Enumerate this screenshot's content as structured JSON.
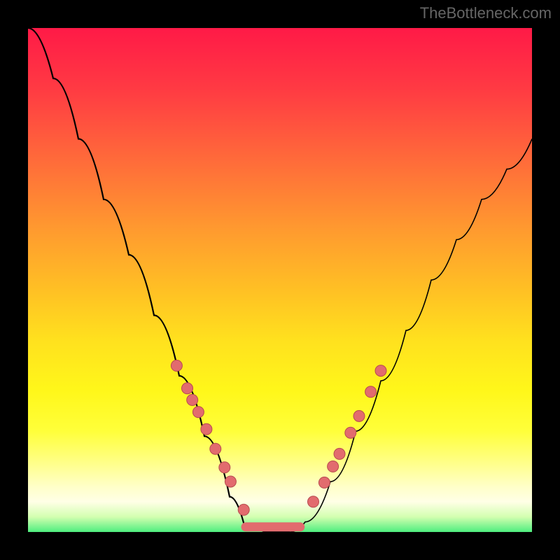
{
  "watermark": "TheBottleneck.com",
  "chart_data": {
    "type": "line",
    "title": "",
    "xlabel": "",
    "ylabel": "",
    "xlim": [
      0,
      1
    ],
    "ylim": [
      0,
      1
    ],
    "background": "vertical-gradient red→yellow→green",
    "series": [
      {
        "name": "bottleneck-curve",
        "color": "#000000",
        "x": [
          0.0,
          0.05,
          0.1,
          0.15,
          0.2,
          0.25,
          0.3,
          0.35,
          0.4,
          0.43,
          0.47,
          0.52,
          0.55,
          0.6,
          0.65,
          0.7,
          0.75,
          0.8,
          0.85,
          0.9,
          0.95,
          1.0
        ],
        "y": [
          1.0,
          0.9,
          0.78,
          0.66,
          0.55,
          0.43,
          0.31,
          0.19,
          0.07,
          0.01,
          0.0,
          0.0,
          0.02,
          0.1,
          0.2,
          0.3,
          0.4,
          0.5,
          0.58,
          0.66,
          0.72,
          0.78
        ]
      },
      {
        "name": "markers-left",
        "color": "#e26b6e",
        "type": "scatter",
        "x": [
          0.295,
          0.316,
          0.326,
          0.338,
          0.354,
          0.372,
          0.39,
          0.402,
          0.428
        ],
        "y": [
          0.33,
          0.285,
          0.262,
          0.238,
          0.204,
          0.165,
          0.128,
          0.1,
          0.044
        ]
      },
      {
        "name": "markers-right",
        "color": "#e26b6e",
        "type": "scatter",
        "x": [
          0.566,
          0.588,
          0.605,
          0.618,
          0.64,
          0.657,
          0.68,
          0.7
        ],
        "y": [
          0.06,
          0.098,
          0.13,
          0.155,
          0.197,
          0.23,
          0.278,
          0.32
        ]
      },
      {
        "name": "flat-bottom",
        "color": "#e26b6e",
        "type": "line",
        "x": [
          0.432,
          0.54
        ],
        "y": [
          0.01,
          0.01
        ]
      }
    ]
  }
}
